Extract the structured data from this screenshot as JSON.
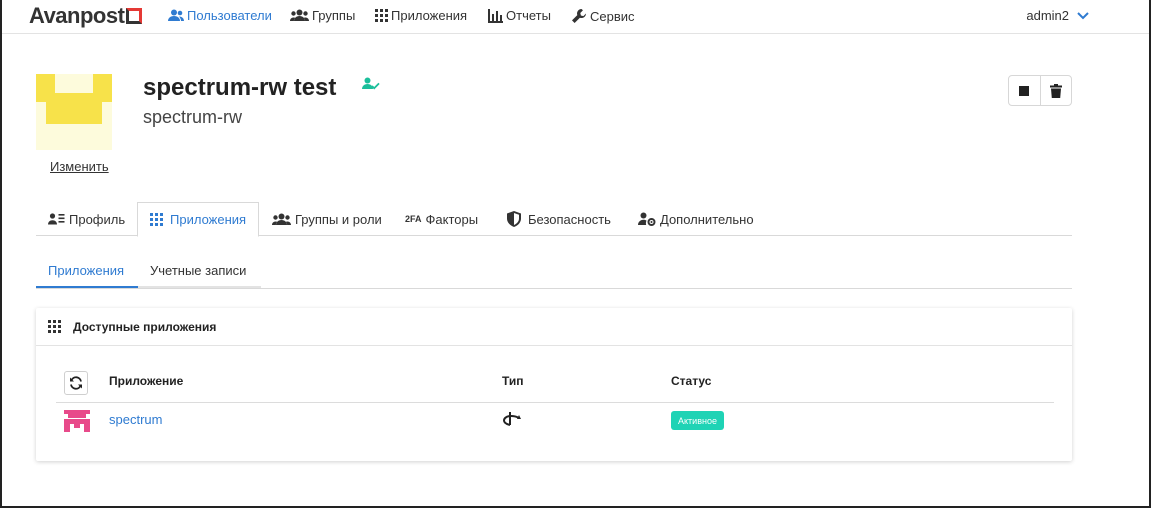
{
  "topnav": {
    "logo_text": "Avanpost",
    "items": [
      {
        "label": "Пользователи",
        "icon": "users-icon",
        "active": true
      },
      {
        "label": "Группы",
        "icon": "groups-icon",
        "active": false
      },
      {
        "label": "Приложения",
        "icon": "grid-icon",
        "active": false
      },
      {
        "label": "Отчеты",
        "icon": "bar-chart-icon",
        "active": false
      },
      {
        "label": "Сервис",
        "icon": "wrench-icon",
        "active": false
      }
    ],
    "user": "admin2"
  },
  "header": {
    "title": "spectrum-rw test",
    "subtitle": "spectrum-rw",
    "change_link": "Изменить"
  },
  "tabs": [
    {
      "label": "Профиль",
      "icon": "profile-icon",
      "active": false
    },
    {
      "label": "Приложения",
      "icon": "grid-icon",
      "active": true
    },
    {
      "label": "Группы и роли",
      "icon": "groups-icon",
      "active": false
    },
    {
      "label": "Факторы",
      "icon": "2fa-icon",
      "prefix": "2FA",
      "active": false
    },
    {
      "label": "Безопасность",
      "icon": "shield-icon",
      "active": false
    },
    {
      "label": "Дополнительно",
      "icon": "user-gear-icon",
      "active": false
    }
  ],
  "subtabs": [
    {
      "label": "Приложения",
      "active": true
    },
    {
      "label": "Учетные записи",
      "active": false
    }
  ],
  "card": {
    "title": "Доступные приложения",
    "columns": [
      "Приложение",
      "Тип",
      "Статус"
    ],
    "rows": [
      {
        "app": "spectrum",
        "type_icon": "openid-icon",
        "status": "Активное"
      }
    ]
  },
  "colors": {
    "accent": "#2f7bd1",
    "status_active": "#1fd3b5",
    "verified": "#1bbf9b",
    "avatar_yellow": "#f7e24a",
    "app_icon_pink": "#e84a8a"
  }
}
